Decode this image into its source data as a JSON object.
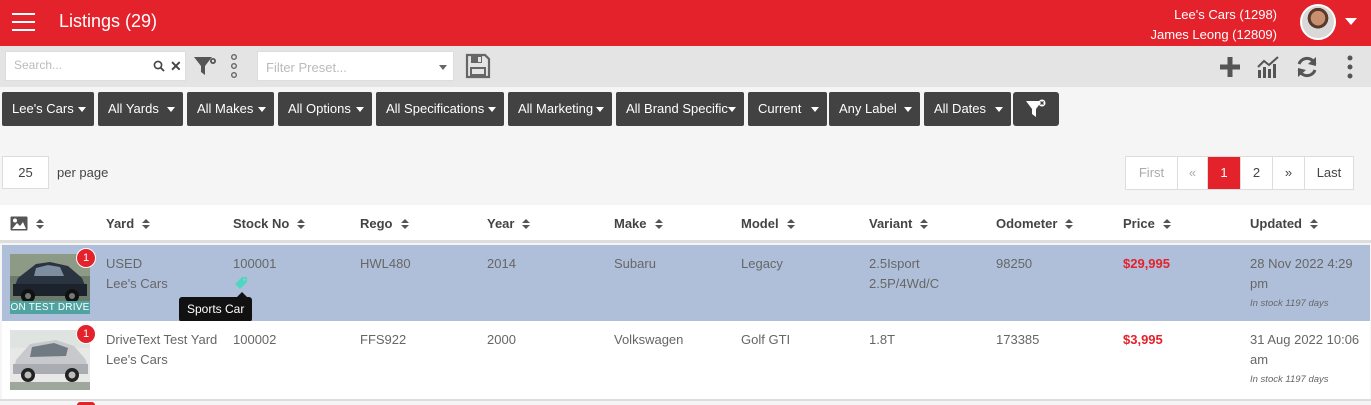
{
  "header": {
    "title": "Listings (29)",
    "dealer": "Lee's Cars (1298)",
    "user": "James Leong (12809)"
  },
  "toolbar": {
    "search_placeholder": "Search...",
    "preset_placeholder": "Filter Preset..."
  },
  "filters": [
    "Lee's Cars",
    "All Yards",
    "All Makes",
    "All Options",
    "All Specifications",
    "All Marketing",
    "All Brand Specific",
    "Current",
    "Any Label",
    "All Dates"
  ],
  "pagination": {
    "per_page_value": "25",
    "per_page_label": "per page",
    "first": "First",
    "prev": "«",
    "pages": [
      "1",
      "2"
    ],
    "current_page": "1",
    "next": "»",
    "last": "Last"
  },
  "table": {
    "columns": [
      "Yard",
      "Stock No",
      "Rego",
      "Year",
      "Make",
      "Model",
      "Variant",
      "Odometer",
      "Price",
      "Updated"
    ],
    "rows": [
      {
        "badge": "1",
        "banner": "ON TEST DRIVE",
        "yard_line1": "USED",
        "yard_line2": "Lee's Cars",
        "stock_no": "100001",
        "tooltip": "Sports Car",
        "rego": "HWL480",
        "year": "2014",
        "make": "Subaru",
        "model": "Legacy",
        "variant_line1": "2.5Isport",
        "variant_line2": "2.5P/4Wd/C",
        "odometer": "98250",
        "price": "$29,995",
        "updated_line1": "28 Nov 2022 4:29",
        "updated_line2": "pm",
        "in_stock": "In stock 1197 days"
      },
      {
        "badge": "1",
        "yard_line1": "DriveText Test Yard",
        "yard_line2": "Lee's Cars",
        "stock_no": "100002",
        "rego": "FFS922",
        "year": "2000",
        "make": "Volkswagen",
        "model": "Golf GTI",
        "variant_line1": "1.8T",
        "odometer": "173385",
        "price": "$3,995",
        "updated_line1": "31 Aug 2022 10:06",
        "updated_line2": "am",
        "in_stock": "In stock 1197 days"
      }
    ]
  },
  "colors": {
    "brand_red": "#e3222b",
    "filter_button": "#424242",
    "selected_row": "#b0bfd9",
    "test_drive_banner": "#4fa3a0"
  }
}
